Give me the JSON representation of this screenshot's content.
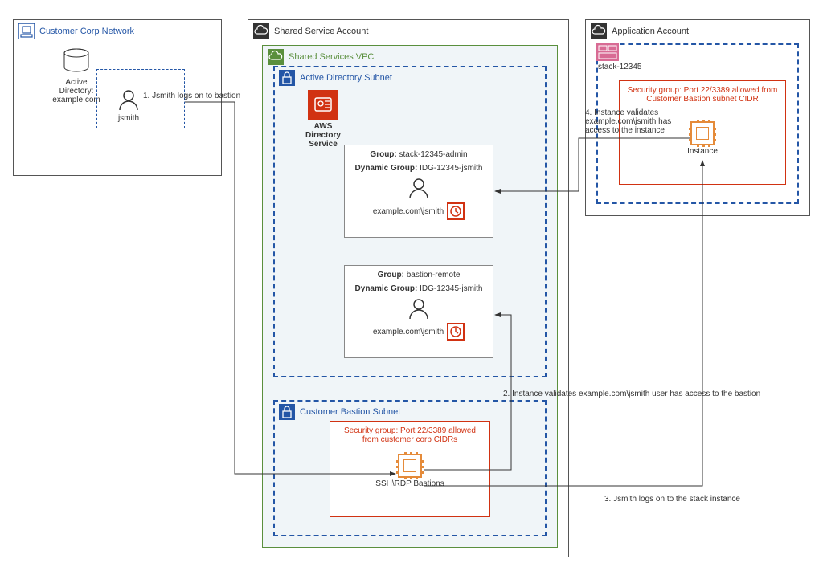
{
  "customer_corp": {
    "title": "Customer Corp Network",
    "ad_label": "Active Directory:",
    "ad_domain": "example.com",
    "user": "jsmith"
  },
  "shared_service": {
    "title": "Shared Service Account",
    "vpc": "Shared Services VPC",
    "ad_subnet": "Active Directory Subnet",
    "ds_label1": "AWS",
    "ds_label2": "Directory Service",
    "group1": {
      "group_label": "Group:",
      "group_name": "stack-12345-admin",
      "dynamic_label": "Dynamic Group:",
      "dynamic_name": "IDG-12345-jsmith",
      "user_path": "example.com\\jsmith"
    },
    "group2": {
      "group_label": "Group:",
      "group_name": "bastion-remote",
      "dynamic_label": "Dynamic Group:",
      "dynamic_name": "IDG-12345-jsmith",
      "user_path": "example.com\\jsmith"
    },
    "bastion_subnet": "Customer Bastion Subnet",
    "bastion_sec": "Security group: Port 22/3389 allowed from customer corp CIDRs",
    "bastion_label": "SSH\\RDP Bastions"
  },
  "application": {
    "title": "Application Account",
    "stack": "stack-12345",
    "sec_group": "Security group: Port 22/3389 allowed from Customer Bastion subnet CIDR",
    "instance_label": "Instance"
  },
  "steps": {
    "s1": "1. Jsmith logs on to bastion",
    "s2": "2. Instance validates example.com\\jsmith user has access to the bastion",
    "s3": "3. Jsmith logs on to the stack instance",
    "s4": "4. Instance validates example.com\\jsmith has access to the instance"
  }
}
